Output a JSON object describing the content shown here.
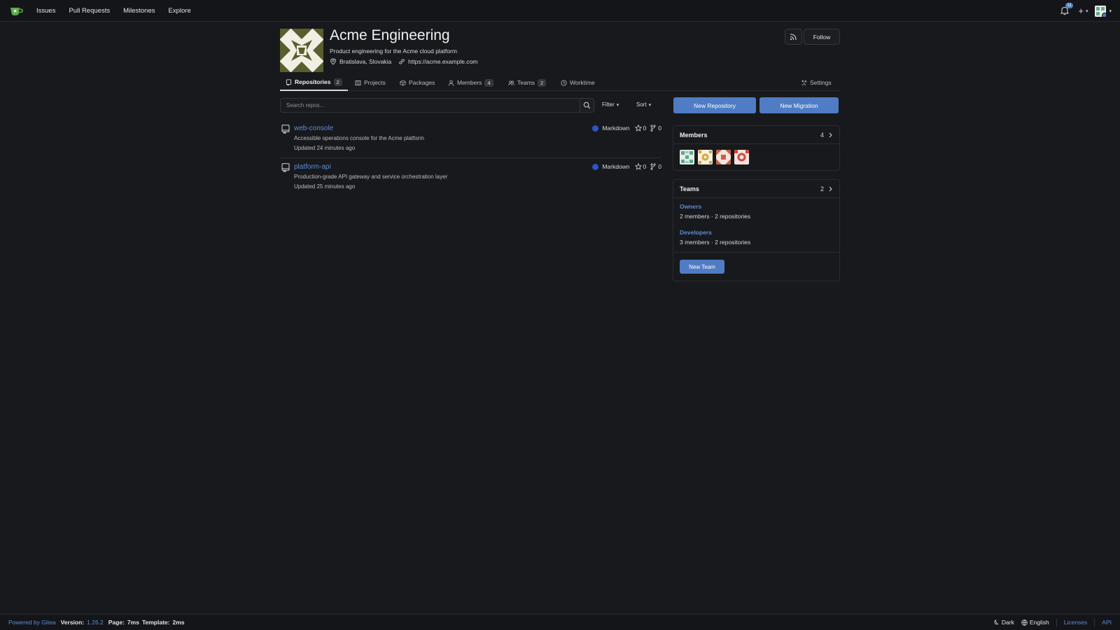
{
  "nav": {
    "links": [
      "Issues",
      "Pull Requests",
      "Milestones",
      "Explore"
    ],
    "notification_count": "11"
  },
  "org": {
    "name": "Acme Engineering",
    "description": "Product engineering for the Acme cloud platform",
    "location": "Bratislava, Slovakia",
    "website": "https://acme.example.com",
    "follow_label": "Follow"
  },
  "tabs": [
    {
      "label": "Repositories",
      "count": "2"
    },
    {
      "label": "Projects"
    },
    {
      "label": "Packages"
    },
    {
      "label": "Members",
      "count": "4"
    },
    {
      "label": "Teams",
      "count": "2"
    },
    {
      "label": "Worktime"
    },
    {
      "label": "Settings"
    }
  ],
  "search": {
    "placeholder": "Search repos...",
    "filter_label": "Filter",
    "sort_label": "Sort",
    "new_repo_label": "New Repository",
    "new_migration_label": "New Migration"
  },
  "repos": [
    {
      "name": "web-console",
      "description": "Accessible operations console for the Acme platform",
      "updated": "Updated 24 minutes ago",
      "language": "Markdown",
      "stars": "0",
      "forks": "0"
    },
    {
      "name": "platform-api",
      "description": "Production-grade API gateway and service orchestration layer",
      "updated": "Updated 25 minutes ago",
      "language": "Markdown",
      "stars": "0",
      "forks": "0"
    }
  ],
  "members_panel": {
    "title": "Members",
    "count": "4"
  },
  "teams_panel": {
    "title": "Teams",
    "count": "2",
    "teams": [
      {
        "name": "Owners",
        "meta": "2 members · 2 repositories"
      },
      {
        "name": "Developers",
        "meta": "3 members · 2 repositories"
      }
    ],
    "new_team_label": "New Team"
  },
  "footer": {
    "powered_by": "Powered by Gitea",
    "version_label": "Version:",
    "version": "1.26.2",
    "page_label": "Page:",
    "page_time": "7ms",
    "template_label": "Template:",
    "template_time": "2ms",
    "theme": "Dark",
    "language": "English",
    "licenses": "Licenses",
    "api": "API"
  },
  "colors": {
    "accent": "#4f7cc4",
    "link": "#5b8ed6",
    "markdown_dot": "#2a55c9"
  }
}
